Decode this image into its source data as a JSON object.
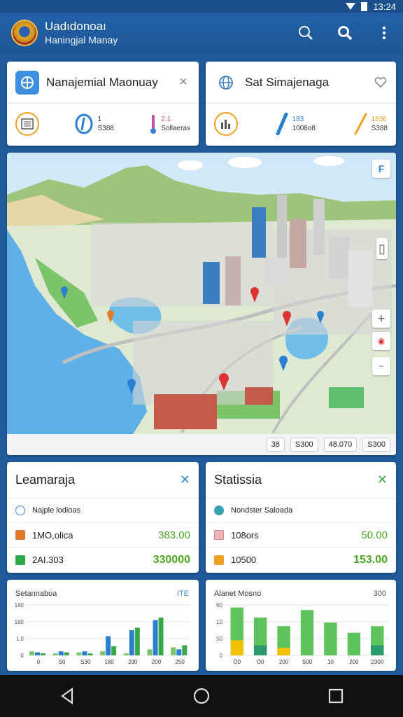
{
  "status_bar": {
    "time": "13:24"
  },
  "app_bar": {
    "title": "Uadıdonoaı",
    "subtitle": "Haningjal Manay",
    "icons": [
      "search-outline-icon",
      "search-icon",
      "more-vert-icon"
    ]
  },
  "top_cards": [
    {
      "title": "Nanajemial Maonuay",
      "stats": [
        {
          "value": "1",
          "label": "S388"
        },
        {
          "value": "2:1",
          "label": "Sollaeras"
        }
      ]
    },
    {
      "title": "Sat Simajenaga",
      "stats": [
        {
          "value": "183",
          "label": "1008o8"
        },
        {
          "value": "1836",
          "label": "S388"
        }
      ]
    }
  ],
  "map": {
    "legend_label": "F",
    "chips": [
      "38",
      "S300",
      "48.070",
      "S300"
    ],
    "colors": {
      "water": "#5fb0e6",
      "land": "#dfe9d2",
      "grass": "#7cc46a",
      "hills": "#9cc47a"
    }
  },
  "info_cards": [
    {
      "title": "Leamaraja",
      "rows": [
        {
          "label": "Najple lodioas",
          "value": ""
        },
        {
          "label": "1MO,olica",
          "value": "383.00"
        },
        {
          "label": "2AI.303",
          "value": "330000"
        }
      ]
    },
    {
      "title": "Statissia",
      "rows": [
        {
          "label": "Nondster Saloada",
          "value": ""
        },
        {
          "label": "108ors",
          "value": "50.00"
        },
        {
          "label": "10500",
          "value": "153.00"
        }
      ]
    }
  ],
  "chart_data": [
    {
      "type": "bar",
      "title": "Setannaboa",
      "badge": "ITE",
      "yticks": [
        "180",
        "180",
        "1.0",
        "0"
      ],
      "categories": [
        "0",
        "S0",
        "S30",
        "180",
        "230",
        "200",
        "250"
      ],
      "series": [
        {
          "values": [
            0.08,
            0.04,
            0.06,
            0.08,
            0.04,
            0.12,
            0.16
          ]
        },
        {
          "values": [
            0.06,
            0.08,
            0.08,
            0.38,
            0.5,
            0.7,
            0.12
          ]
        },
        {
          "values": [
            0.04,
            0.06,
            0.04,
            0.18,
            0.55,
            0.75,
            0.2
          ]
        }
      ]
    },
    {
      "type": "bar",
      "title": "Alanet Mosno",
      "badge": "300",
      "yticks": [
        "60",
        "10",
        "50",
        "0"
      ],
      "categories": [
        "Ö0",
        "Ö0",
        "200",
        "S00",
        "10",
        "200",
        "2300"
      ],
      "series": [
        {
          "values": [
            0.95,
            0.75,
            0.58,
            0.9,
            0.65,
            0.45,
            0.58
          ]
        },
        {
          "values": [
            0.3,
            0.2,
            0.15,
            0.0,
            0.0,
            0.0,
            0.2
          ]
        }
      ]
    }
  ]
}
